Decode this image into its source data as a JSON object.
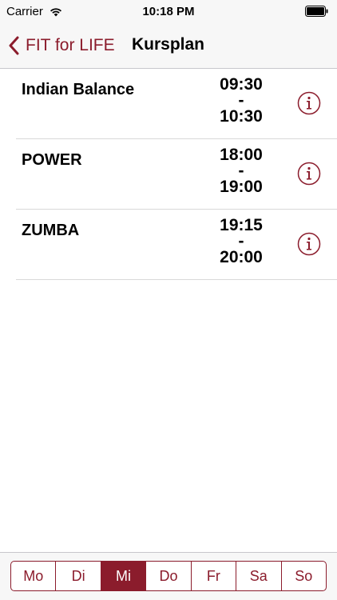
{
  "status_bar": {
    "carrier": "Carrier",
    "time": "10:18 PM"
  },
  "nav": {
    "back_label": "FIT for LIFE",
    "title": "Kursplan"
  },
  "courses": [
    {
      "name": "Indian Balance",
      "start": "09:30",
      "separator": "-",
      "end": "10:30"
    },
    {
      "name": "POWER",
      "start": "18:00",
      "separator": "-",
      "end": "19:00"
    },
    {
      "name": "ZUMBA",
      "start": "19:15",
      "separator": "-",
      "end": "20:00"
    }
  ],
  "days": [
    "Mo",
    "Di",
    "Mi",
    "Do",
    "Fr",
    "Sa",
    "So"
  ],
  "selected_day": "Mi",
  "colors": {
    "accent": "#8b1c2c",
    "bar_background": "#f7f7f7"
  }
}
